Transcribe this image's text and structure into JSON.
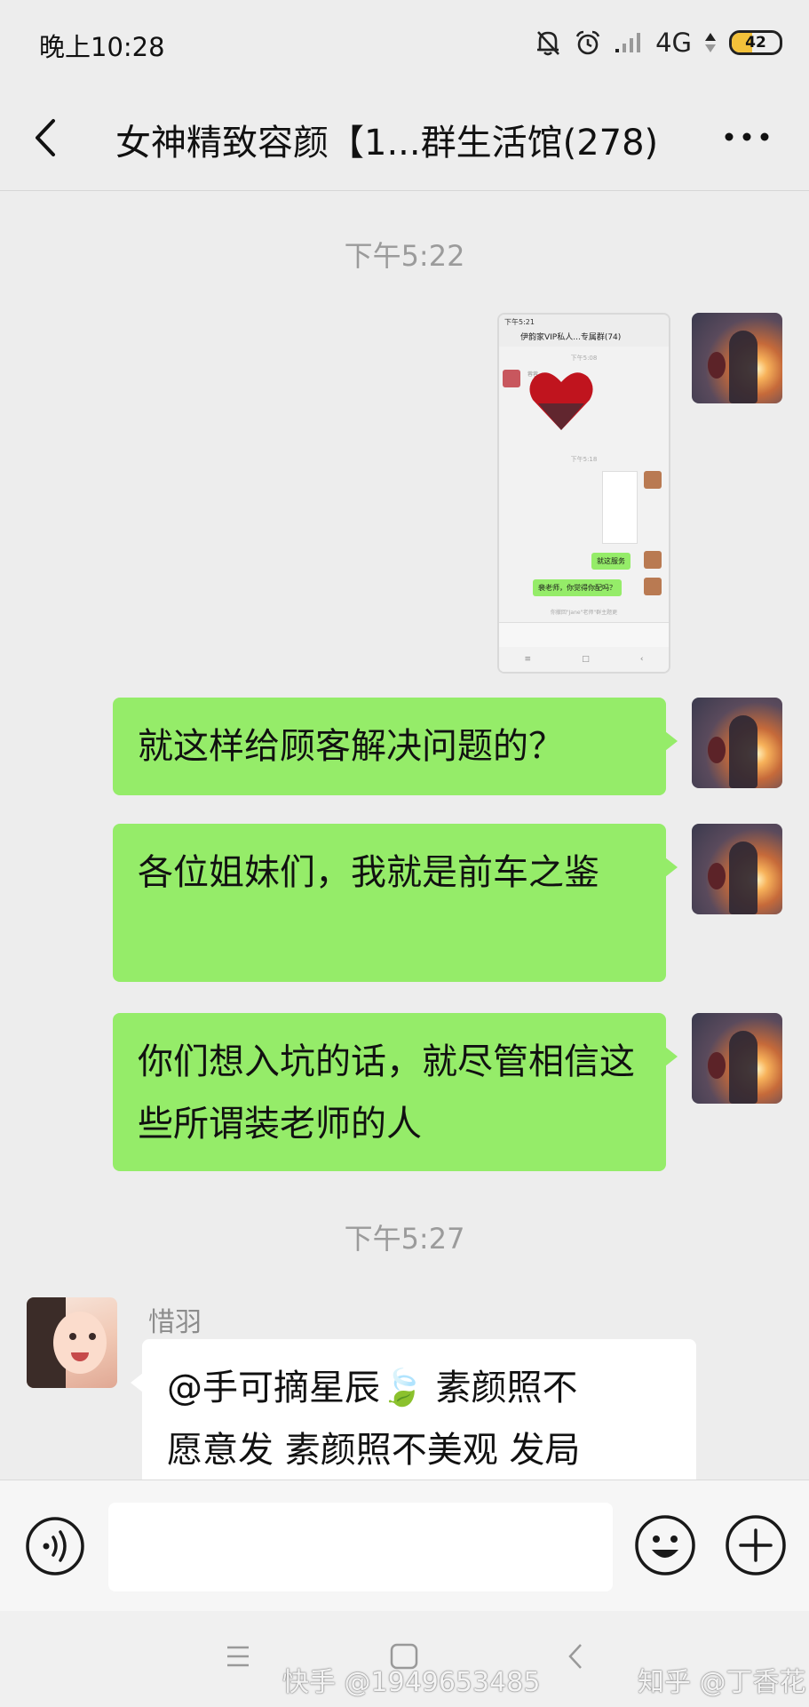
{
  "status_bar": {
    "time": "晚上10:28",
    "network": "4G",
    "battery": "42",
    "battery_level": 0.42,
    "icons": [
      "mute-bell-icon",
      "alarm-icon",
      "signal-icon",
      "network-arrows-icon",
      "battery-icon"
    ]
  },
  "header": {
    "title": "女神精致容颜【1...群生活馆(278)",
    "back_icon": "chevron-left-icon",
    "more_icon": "more-dots-icon"
  },
  "chat": {
    "timestamp_1": "下午5:22",
    "image_message": {
      "status_time": "下午5:21",
      "title": "伊韵家VIP私人...专属群(74)",
      "ts_1": "下午5:08",
      "sender": "蓉蓉",
      "ts_2": "下午5:18",
      "bubble_1": "就这服务",
      "bubble_2": "裴老师，你觉得你配吗？",
      "note": "你撤回\"Jane\"老师\"群主题更",
      "nav": [
        "≡",
        "□",
        "‹"
      ]
    },
    "messages_out": [
      "就这样给顾客解决问题的？",
      "各位姐妹们，我就是前车之鉴",
      "你们想入坑的话，就尽管相信这些所谓装老师的人"
    ],
    "timestamp_2": "下午5:27",
    "incoming": {
      "sender": "惜羽",
      "text_line_1": "@手可摘星辰🍃  素颜照不",
      "text_line_2": "愿意发  素颜照不美观 发局"
    }
  },
  "input_bar": {
    "voice_icon": "voice-icon",
    "emoji_icon": "emoji-icon",
    "plus_icon": "plus-icon",
    "placeholder": ""
  },
  "watermarks": {
    "left": "快手 @1949653485",
    "right": "知乎 @丁香花"
  },
  "colors": {
    "background": "#ededed",
    "bubble_out": "#95ec69",
    "bubble_in": "#ffffff",
    "timestamp": "#9b9b9b"
  }
}
